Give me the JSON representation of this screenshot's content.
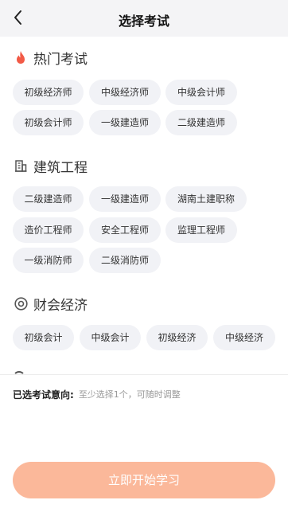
{
  "header": {
    "title": "选择考试",
    "back_icon": "chevron-left-icon"
  },
  "sections": [
    {
      "title": "热门考试",
      "icon": "flame-icon",
      "icon_color": "#f25a46",
      "items": [
        "初级经济师",
        "中级经济师",
        "中级会计师",
        "初级会计师",
        "一级建造师",
        "二级建造师"
      ]
    },
    {
      "title": "建筑工程",
      "icon": "building-icon",
      "icon_color": "#555555",
      "items": [
        "二级建造师",
        "一级建造师",
        "湖南土建职称",
        "造价工程师",
        "安全工程师",
        "监理工程师",
        "一级消防师",
        "二级消防师"
      ]
    },
    {
      "title": "财会经济",
      "icon": "target-circle-icon",
      "icon_color": "#555555",
      "items": [
        "初级会计",
        "中级会计",
        "初级经济",
        "中级经济"
      ]
    }
  ],
  "selection": {
    "label": "已选考试意向:",
    "hint": "至少选择1个，可随时调整"
  },
  "actions": {
    "start_label": "立即开始学习",
    "start_color": "#fbb89a"
  }
}
